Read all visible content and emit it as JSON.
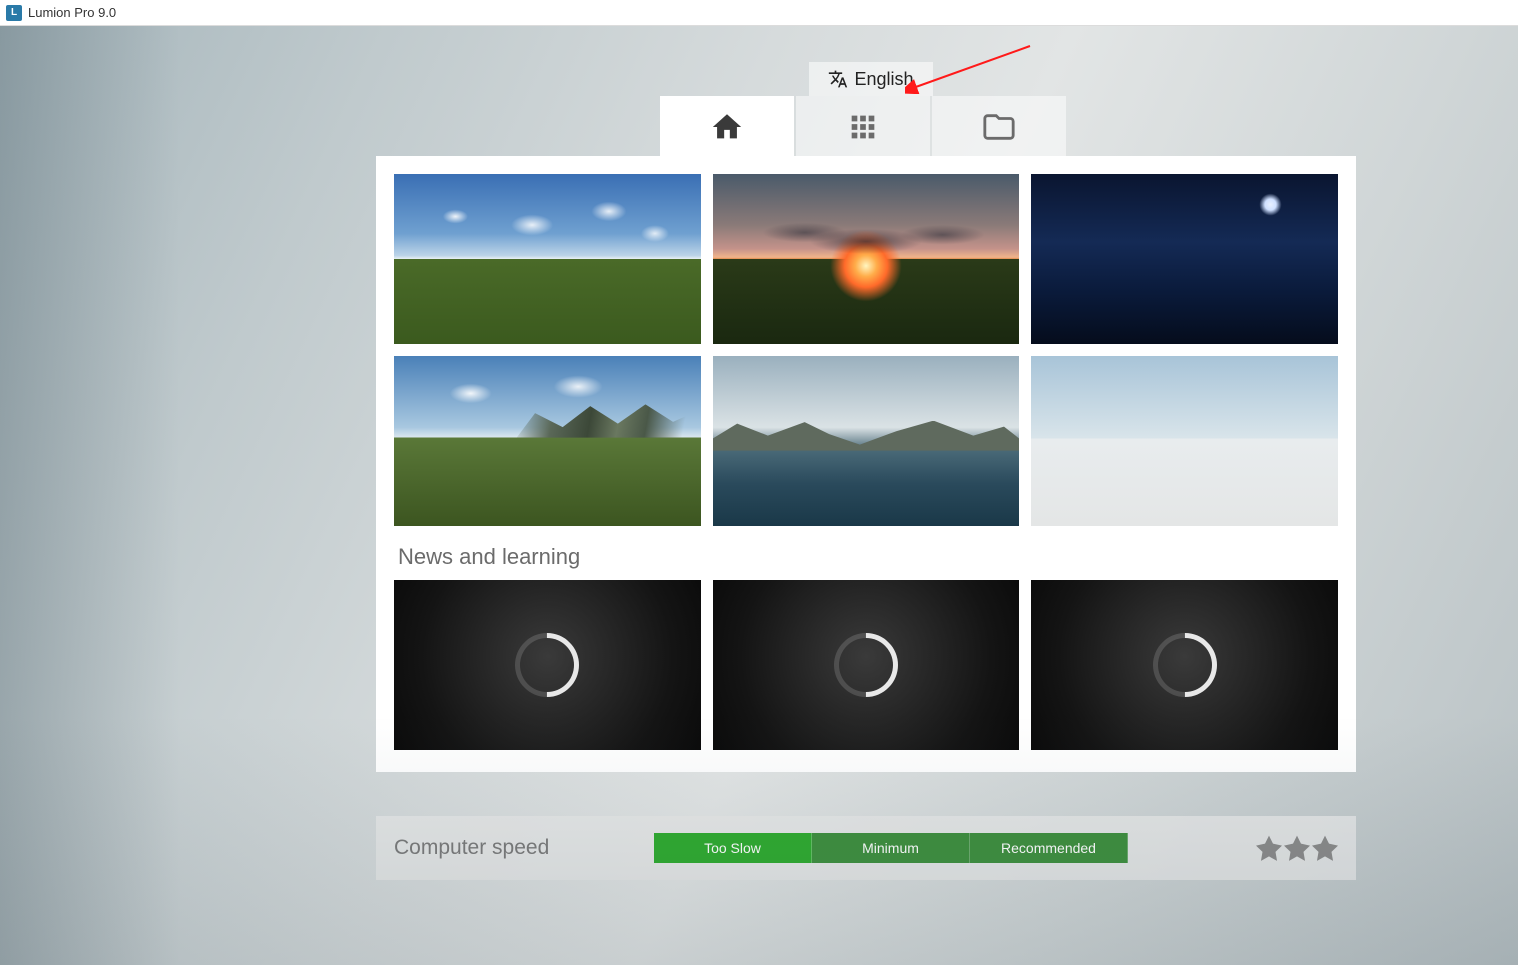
{
  "app_title": "Lumion Pro 9.0",
  "language": {
    "label": "English"
  },
  "tabs": {
    "home": "home-icon",
    "grid": "grid-icon",
    "folder": "folder-icon"
  },
  "scenes": [
    {
      "name": "scene-day"
    },
    {
      "name": "scene-sunset"
    },
    {
      "name": "scene-night"
    },
    {
      "name": "scene-mountain"
    },
    {
      "name": "scene-lake"
    },
    {
      "name": "scene-plain"
    }
  ],
  "section_news_title": "News and learning",
  "footer": {
    "label": "Computer speed",
    "chips": {
      "too_slow": "Too Slow",
      "minimum": "Minimum",
      "recommended": "Recommended"
    }
  }
}
